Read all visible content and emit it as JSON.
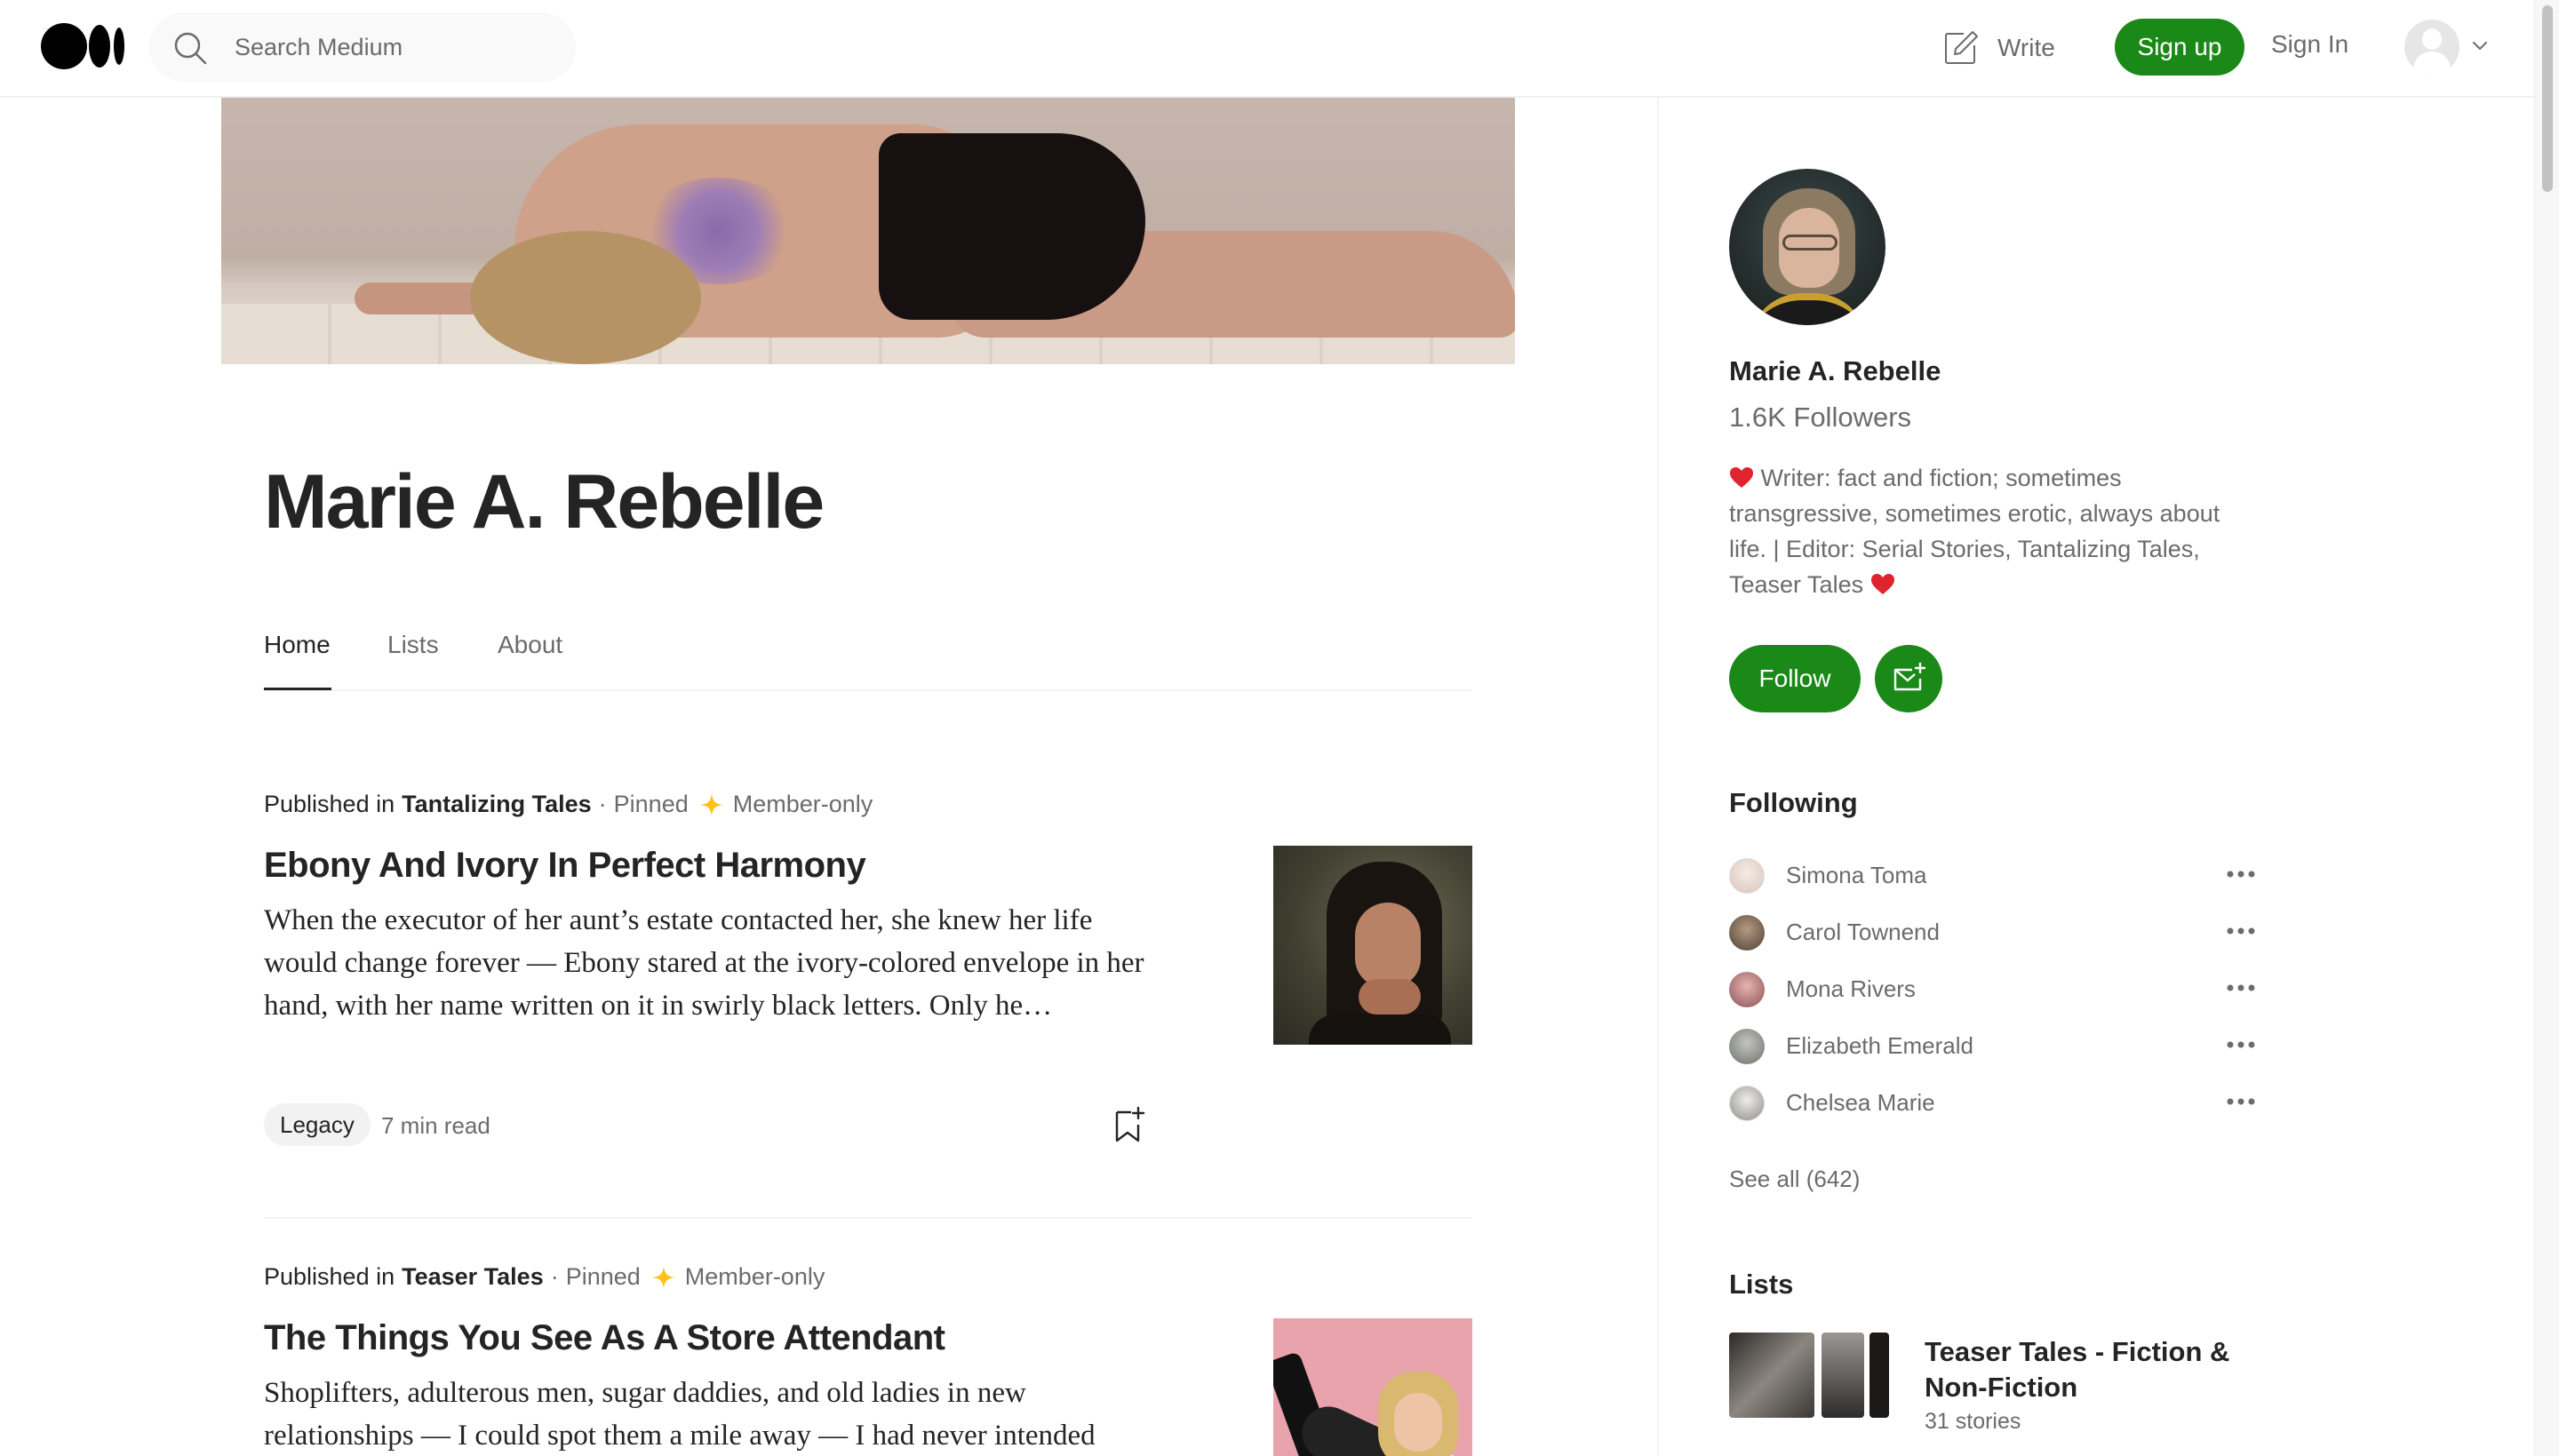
{
  "header": {
    "search_placeholder": "Search Medium",
    "write_label": "Write",
    "signup_label": "Sign up",
    "signin_label": "Sign In"
  },
  "profile": {
    "name": "Marie A. Rebelle",
    "tabs": [
      {
        "label": "Home",
        "active": true
      },
      {
        "label": "Lists",
        "active": false
      },
      {
        "label": "About",
        "active": false
      }
    ]
  },
  "articles": [
    {
      "published_in_label": "Published in",
      "publication": "Tantalizing Tales",
      "separator": "·",
      "pinned": "Pinned",
      "member": "Member-only",
      "title": "Ebony And Ivory In Perfect Harmony",
      "subtitle": "When the executor of her aunt’s estate contacted her, she knew her life would change forever — Ebony stared at the ivory-colored envelope in her hand, with her name written on it in swirly black letters. Only he…",
      "tag": "Legacy",
      "read_time": "7 min read"
    },
    {
      "published_in_label": "Published in",
      "publication": "Teaser Tales",
      "separator": "·",
      "pinned": "Pinned",
      "member": "Member-only",
      "title": "The Things You See As A Store Attendant",
      "subtitle": "Shoplifters, adulterous men, sugar daddies, and old ladies in new relationships — I could spot them a mile away — I had never intended"
    }
  ],
  "sidebar": {
    "name": "Marie A. Rebelle",
    "followers": "1.6K Followers",
    "bio": "Writer: fact and fiction; sometimes transgressive, sometimes erotic, always about life. | Editor: Serial Stories, Tantalizing Tales, Teaser Tales",
    "follow_label": "Follow",
    "following_heading": "Following",
    "following": [
      {
        "name": "Simona Toma",
        "color": "#e8dcd4"
      },
      {
        "name": "Carol Townend",
        "color": "#6b5a4c"
      },
      {
        "name": "Mona Rivers",
        "color": "#a56a70"
      },
      {
        "name": "Elizabeth Emerald",
        "color": "#8a8c88"
      },
      {
        "name": "Chelsea Marie",
        "color": "#b8b6b2"
      }
    ],
    "see_all": "See all (642)",
    "lists_heading": "Lists",
    "list": {
      "title": "Teaser Tales - Fiction & Non-Fiction",
      "count": "31 stories"
    }
  },
  "colors": {
    "accent": "#1a8917",
    "star": "#ffc017",
    "heart": "#e0242f"
  }
}
